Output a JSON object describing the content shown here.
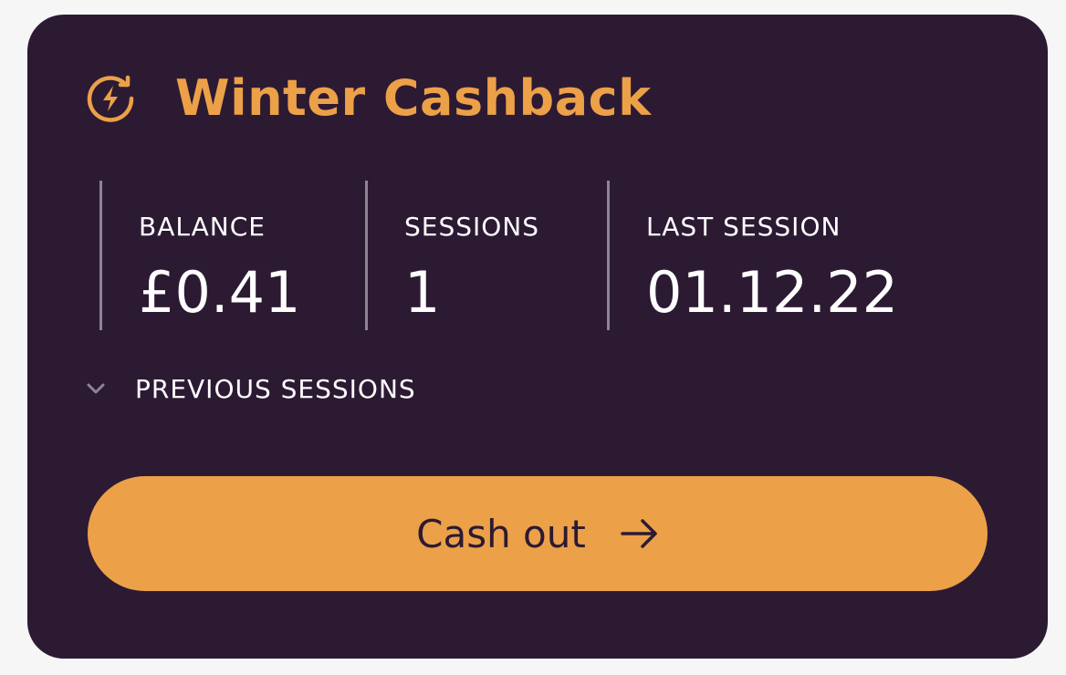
{
  "card": {
    "title": "Winter Cashback",
    "title_icon": "cashback-bolt-icon",
    "accent_color": "#eca048",
    "background_color": "#2c1a33"
  },
  "stats": [
    {
      "label": "BALANCE",
      "value": "£0.41"
    },
    {
      "label": "SESSIONS",
      "value": "1"
    },
    {
      "label": "LAST SESSION",
      "value": "01.12.22"
    }
  ],
  "previous_sessions": {
    "label": "PREVIOUS SESSIONS",
    "icon": "chevron-down-icon"
  },
  "cash_out": {
    "label": "Cash out",
    "icon": "arrow-right-icon"
  }
}
